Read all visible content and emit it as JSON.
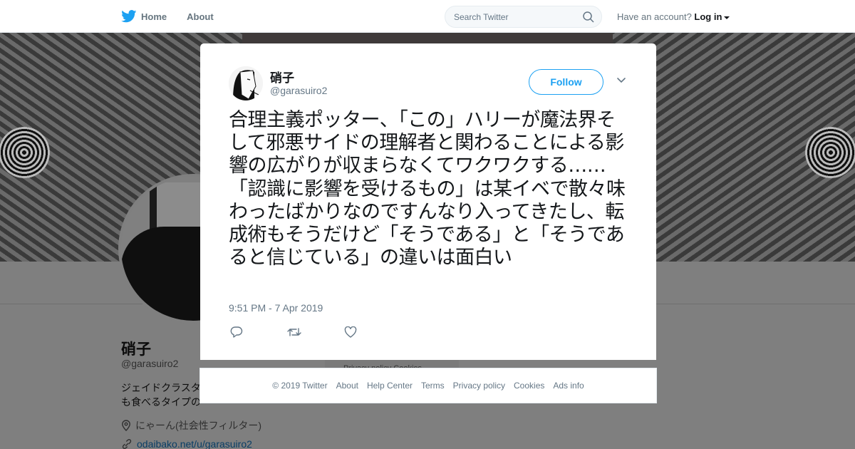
{
  "colors": {
    "brand": "#1da1f2",
    "overlay": "#7f7f7f"
  },
  "topbar": {
    "home_label": "Home",
    "about_label": "About",
    "search_placeholder": "Search Twitter",
    "account_prompt": "Have an account?",
    "login_label": "Log in"
  },
  "profile": {
    "name": "硝子",
    "handle": "@garasuiro2",
    "bio_line1": "ジェイドクラスタ",
    "bio_line2": "も食べるタイプの",
    "location": "にゃーん(社会性フィルター)",
    "link": "odaibako.net/u/garasuiro2",
    "side_footer_text": "Privacy policy   Cookies"
  },
  "tweet": {
    "author_name": "硝子",
    "author_handle": "@garasuiro2",
    "follow_label": "Follow",
    "text": "合理主義ポッター、「この」ハリーが魔法界そして邪悪サイドの理解者と関わることによる影響の広がりが収まらなくてワクワクする……「認識に影響を受けるもの」は某イベで散々味わったばかりなのですんなり入ってきたし、転成術もそうだけど「そうである」と「そうであると信じている」の違いは面白い",
    "timestamp": "9:51 PM - 7 Apr 2019",
    "actions": [
      "reply-icon",
      "retweet-icon",
      "like-icon"
    ]
  },
  "footer": {
    "links": [
      "© 2019 Twitter",
      "About",
      "Help Center",
      "Terms",
      "Privacy policy",
      "Cookies",
      "Ads info"
    ]
  }
}
